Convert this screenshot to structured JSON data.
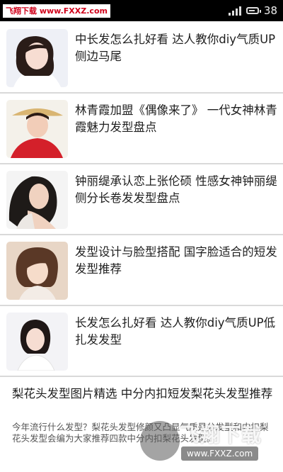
{
  "status_bar": {
    "watermark": "飞翔下载 www.FXXZ.com",
    "time": "38"
  },
  "articles": [
    {
      "title": "中长发怎么扎好看 达人教你diy气质UP侧边马尾",
      "thumb_icon": "portrait-photo"
    },
    {
      "title": "林青霞加盟《偶像来了》 一代女神林青霞魅力发型盘点",
      "thumb_icon": "portrait-photo"
    },
    {
      "title": "钟丽缇承认恋上张伦硕 性感女神钟丽缇侧分长卷发发型盘点",
      "thumb_icon": "portrait-photo"
    },
    {
      "title": "发型设计与脸型搭配 国字脸适合的短发发型推荐",
      "thumb_icon": "portrait-photo"
    },
    {
      "title": "长发怎么扎好看 达人教你diy气质UP低扎发发型",
      "thumb_icon": "portrait-photo"
    }
  ],
  "last_article": {
    "title": "梨花头发型图片精选 中分内扣短发梨花头发型推荐",
    "description": "今年流行什么发型？梨花头发型修颜又凸显气质是分发型和内扣梨花头发型会编为大家推荐四款中分内扣梨花头发型。"
  },
  "watermark_bottom": {
    "brand": "飞翔下载",
    "url": "www.FXXZ.com"
  }
}
